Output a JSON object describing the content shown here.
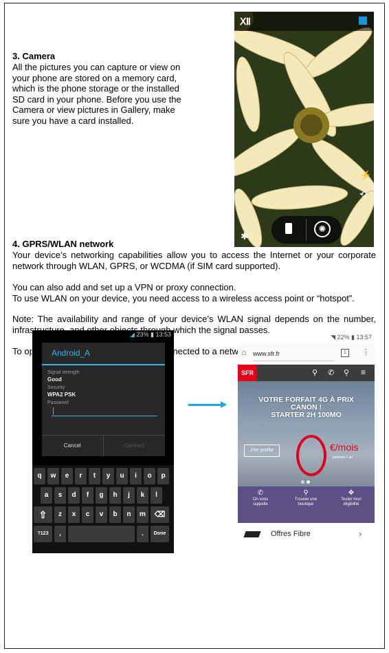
{
  "section3": {
    "heading": "3. Camera",
    "lines": [
      "All the pictures you can capture or view on",
      "your phone are stored on a memory card,",
      "which is the phone storage or the installed",
      "SD card in your phone. Before you use the",
      "Camera or view pictures in Gallery, make",
      "sure you have a card installed."
    ]
  },
  "section4": {
    "heading": "4. GPRS/WLAN network",
    "p1": "Your device’s networking capabilities allow you to access the Internet or your corporate network through WLAN, GPRS, or WCDMA (if SIM card supported).",
    "p2": "You can also add and set up a VPN or proxy connection.",
    "p3": "To use WLAN on your device, you need access to a wireless access point or “hotspot”.",
    "p4": "Note: The availability and range of your device’s WLAN signal depends on the number, infrastructure, and other objects through which the signal passes.",
    "p5": "To open the Browser you need to be connected to a network."
  },
  "wifi_screen": {
    "status": "23% ▮ 13:53",
    "title": "Android_A",
    "signal_label": "Signal strength",
    "signal_value": "Good",
    "security_label": "Security",
    "security_value": "WPA2 PSK",
    "password_label": "Password",
    "cancel": "Cancel",
    "connect": "Connect",
    "row1": [
      "q",
      "w",
      "e",
      "r",
      "t",
      "y",
      "u",
      "i",
      "o",
      "p"
    ],
    "row2": [
      "a",
      "s",
      "d",
      "f",
      "g",
      "h",
      "j",
      "k",
      "l"
    ],
    "row3": [
      "z",
      "x",
      "c",
      "v",
      "b",
      "n",
      "m"
    ],
    "sym": "?123",
    "comma": ",",
    "dot": ".",
    "done": "Done"
  },
  "browser_screen": {
    "status": "22% ▮ 13:57",
    "url": "www.sfr.fr",
    "logo": "SFR",
    "hero_l1": "VOTRE FORFAIT 4G À PRIX",
    "hero_l2": "CANON !",
    "hero_l3": "STARTER 2H 100MO",
    "cta": "J'en profite",
    "price": "€/mois",
    "price_note": "pendant 1 an",
    "tile1a": "On vous",
    "tile1b": "rappelle",
    "tile2a": "Trouver une",
    "tile2b": "boutique",
    "tile3a": "Tester mon",
    "tile3b": "éligibilité",
    "offer": "Offres Fibre"
  },
  "colors": {
    "accent": "#33b5e5",
    "sfr_red": "#e2001a",
    "arrow": "#1ba7e2"
  }
}
